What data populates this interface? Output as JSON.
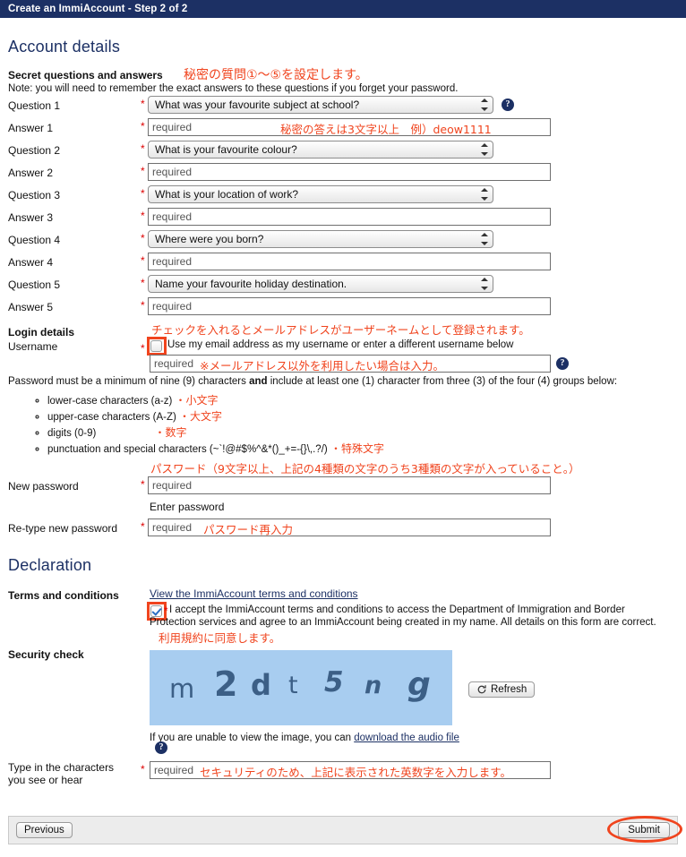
{
  "header": {
    "title": "Create an ImmiAccount - Step 2 of 2"
  },
  "sections": {
    "account_details": "Account details",
    "declaration": "Declaration"
  },
  "secret": {
    "heading": "Secret questions and answers",
    "annotation_jp": "秘密の質問①〜⑤を設定します。",
    "note": "Note: you will need to remember the exact answers to these questions if you forget your password.",
    "answer1_annotation_jp": "秘密の答えは3文字以上　例）deow1111",
    "rows": [
      {
        "label": "Question 1",
        "type": "select",
        "value": "What was your favourite subject at school?"
      },
      {
        "label": "Answer 1",
        "type": "text",
        "placeholder": "required"
      },
      {
        "label": "Question 2",
        "type": "select",
        "value": "What is your favourite colour?"
      },
      {
        "label": "Answer 2",
        "type": "text",
        "placeholder": "required"
      },
      {
        "label": "Question 3",
        "type": "select",
        "value": "What is your location of work?"
      },
      {
        "label": "Answer 3",
        "type": "text",
        "placeholder": "required"
      },
      {
        "label": "Question 4",
        "type": "select",
        "value": "Where were you born?"
      },
      {
        "label": "Answer 4",
        "type": "text",
        "placeholder": "required"
      },
      {
        "label": "Question 5",
        "type": "select",
        "value": "Name your favourite holiday destination."
      },
      {
        "label": "Answer 5",
        "type": "text",
        "placeholder": "required"
      }
    ]
  },
  "login": {
    "heading": "Login details",
    "username_label": "Username",
    "checkbox_annotation_jp": "チェックを入れるとメールアドレスがユーザーネームとして登録されます。",
    "checkbox_label": "Use my email address as my username or enter a different username below",
    "checkbox_checked": false,
    "username_placeholder": "required",
    "username_annotation_jp": "※メールアドレス以外を利用したい場合は入力。"
  },
  "password": {
    "rule_intro_a": "Password must be a minimum of nine (9) characters ",
    "rule_intro_b": "and",
    "rule_intro_c": " include at least one (1) character from three (3) of the four (4) groups below:",
    "rules": [
      {
        "text": "lower-case characters (a-z)",
        "jp": "・小文字"
      },
      {
        "text": "upper-case characters (A-Z)",
        "jp": "・大文字"
      },
      {
        "text": "digits (0-9)",
        "jp": "・数字"
      },
      {
        "text": "punctuation and special characters (~`!@#$%^&*()_+=-{}\\,.?/)",
        "jp": "・特殊文字"
      }
    ],
    "summary_jp": "パスワード（9文字以上、上記の4種類の文字のうち3種類の文字が入っていること。）",
    "new_label": "New password",
    "new_placeholder": "required",
    "hint": "Enter password",
    "retype_label": "Re-type new password",
    "retype_placeholder": "required",
    "retype_annotation_jp": "パスワード再入力"
  },
  "declaration": {
    "terms_label": "Terms and conditions",
    "terms_link": "View the ImmiAccount terms and conditions",
    "accept_checked": true,
    "accept_text_line1": "I accept the ImmiAccount terms and conditions to access the Department of Immigration and Border",
    "accept_text_line2": "Protection services and agree to an ImmiAccount being created in my name. All details on this form are correct.",
    "accept_annotation_jp": "利用規約に同意します。"
  },
  "security": {
    "label": "Security check",
    "captcha_characters": [
      "m",
      "2",
      "d",
      "t",
      "5",
      "n",
      "g"
    ],
    "captcha_text": "m2dt5ng",
    "refresh_label": "Refresh",
    "refresh_icon": "refresh-icon",
    "audio_prefix": "If you are unable to view the image, you can ",
    "audio_link": "download the audio file",
    "type_label_line1": "Type in the characters",
    "type_label_line2": "you see or hear",
    "type_placeholder": "required",
    "type_annotation_jp": "セキュリティのため、上記に表示された英数字を入力します。"
  },
  "footer": {
    "previous_label": "Previous",
    "submit_label": "Submit"
  },
  "colors": {
    "header_bg": "#1c3064",
    "annotation_red": "#f0441e",
    "captcha_bg": "#a8cdf0",
    "link": "#1c3064"
  }
}
